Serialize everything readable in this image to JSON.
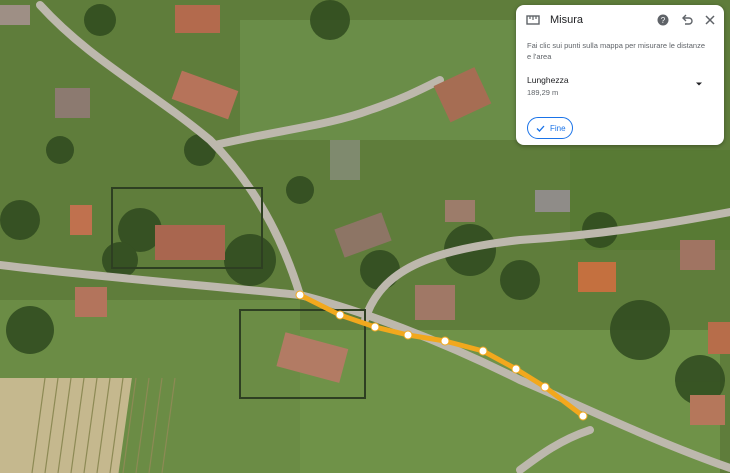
{
  "panel": {
    "title": "Misura",
    "instructions": "Fai clic sui punti sulla mappa per misurare le distanze e l'area",
    "length_label": "Lunghezza",
    "length_value": "189,29 m",
    "done_label": "Fine",
    "icons": [
      "ruler-icon",
      "help-icon",
      "undo-icon",
      "close-icon",
      "dropdown-arrow-icon",
      "check-icon"
    ]
  },
  "map": {
    "type": "satellite",
    "measure_path_color": "#f2a81d",
    "measure_point_color": "#ffffff"
  },
  "colors": {
    "accent": "#1a73e8",
    "panel_bg": "#ffffff"
  }
}
